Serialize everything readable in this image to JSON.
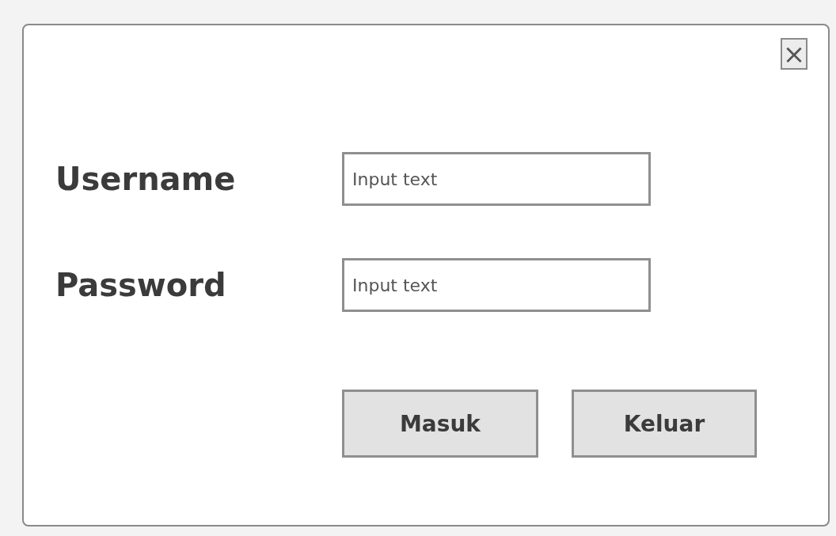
{
  "dialog": {
    "close_label": "×",
    "fields": [
      {
        "label": "Username",
        "placeholder": "Input text"
      },
      {
        "label": "Password",
        "placeholder": "Input text"
      }
    ],
    "buttons": [
      "Masuk",
      "Keluar"
    ]
  }
}
